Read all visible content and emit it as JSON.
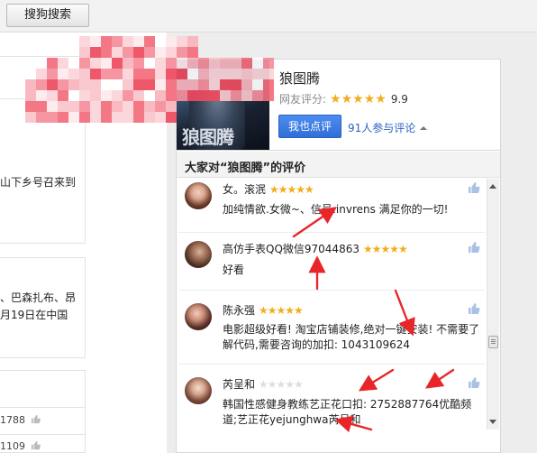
{
  "toolbar": {
    "search_button_label": "搜狗搜索"
  },
  "left_column": {
    "snippet_1": "山下乡号召来到",
    "snippet_2a": "、巴森扎布、昂",
    "snippet_2b": "月19日在中国",
    "count_1": "1788",
    "count_2": "1109"
  },
  "movie": {
    "title": "狼图腾",
    "rating_label": "网友评分:",
    "stars": "★★★★★",
    "score": "9.9",
    "comment_button": "我也点评",
    "participants": "91人参与评论",
    "poster_title": "狼图腾"
  },
  "reviews": {
    "section_title": "大家对“狼图腾”的评价",
    "items": [
      {
        "user": "女。滚泯",
        "stars_on": "★★★★★",
        "stars_off": "",
        "text": "加纯情欲.女微~、信号:invrens 满足你的一切!"
      },
      {
        "user": "高仿手表QQ微信97044863",
        "stars_on": "★★★★★",
        "stars_off": "",
        "text": "好看"
      },
      {
        "user": "陈永强",
        "stars_on": "★★★★★",
        "stars_off": "",
        "text": "电影超级好看! 淘宝店铺装修,绝对一键安装! 不需要了解代码,需要咨询的加扣: 1043109624"
      },
      {
        "user": "芮呈和",
        "stars_on": "",
        "stars_off": "★★★★★",
        "text": "韩国性感健身教练艺正花口扣: 2752887764优酷频道;艺正花yejunghwa芮呈和"
      }
    ]
  },
  "colors": {
    "accent_blue": "#2f6fd8",
    "star_gold": "#f1ad1c",
    "annotation_red": "#e8262a"
  }
}
